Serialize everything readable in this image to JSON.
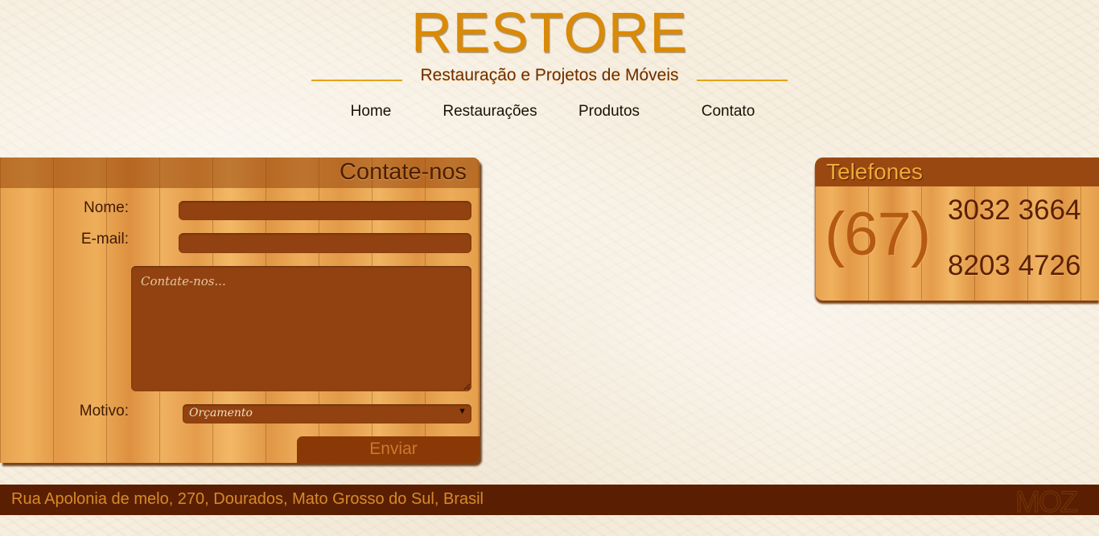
{
  "header": {
    "logo": "RESTORE",
    "tagline": "Restauração e Projetos de Móveis"
  },
  "nav": [
    {
      "label": "Home"
    },
    {
      "label": "Restaurações"
    },
    {
      "label": "Produtos"
    },
    {
      "label": "Contato"
    }
  ],
  "contact": {
    "title": "Contate-nos",
    "name_label": "Nome:",
    "name_value": "",
    "email_label": "E-mail:",
    "email_value": "",
    "message_placeholder": "Contate-nos...",
    "reason_label": "Motivo:",
    "reason_selected": "Orçamento",
    "submit_label": "Enviar"
  },
  "phones": {
    "title": "Telefones",
    "area_code": "(67)",
    "numbers": [
      "3032 3664",
      "8203 4726"
    ]
  },
  "footer": {
    "address": "Rua Apolonia de melo, 270, Dourados, Mato Grosso do Sul, Brasil",
    "logo": "MOZ"
  },
  "colors": {
    "brand_orange": "#d98a07",
    "dark_brown": "#5a1f02",
    "field_brown": "#924210"
  }
}
